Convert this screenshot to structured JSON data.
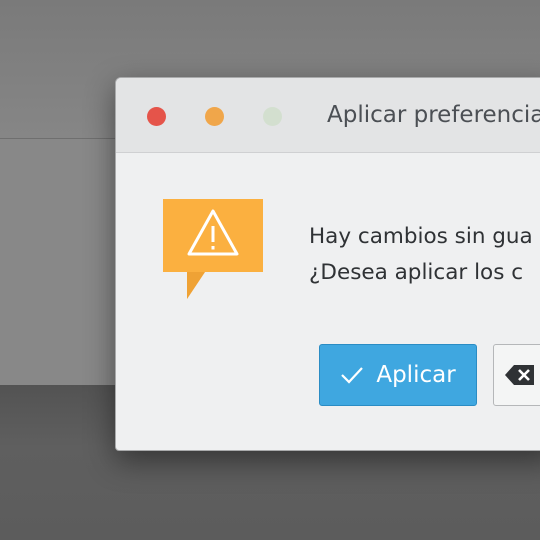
{
  "dialog": {
    "title": "Aplicar preferencia",
    "message_line1": "Hay cambios sin gua",
    "message_line2": "¿Desea aplicar los c",
    "apply_label": "Aplicar",
    "warning_icon": "warning-speech-bubble-icon",
    "clear_icon": "backspace-clear-icon"
  },
  "colors": {
    "close": "#e5544a",
    "minimize": "#f0a64a",
    "maximize": "#d3dfcf",
    "accent": "#3fa7e0",
    "warning": "#fbb040"
  }
}
